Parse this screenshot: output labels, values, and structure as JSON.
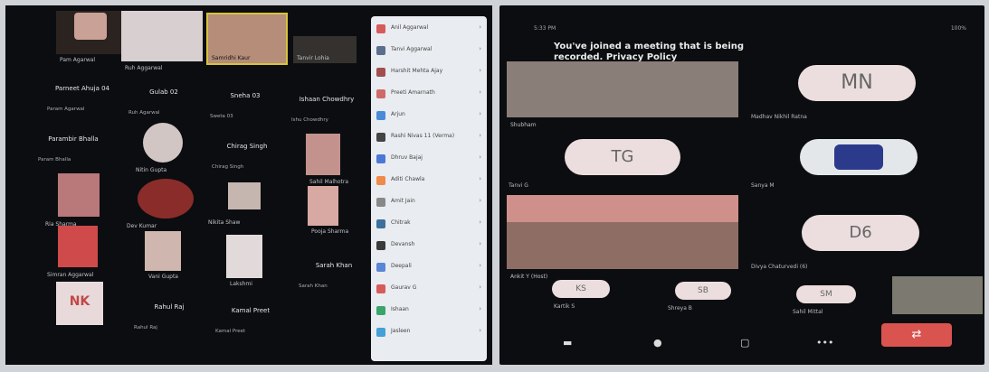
{
  "left_panel": {
    "top_tiles": [
      {
        "name": "Pam Agarwal",
        "color": "#c9a197"
      },
      {
        "name": "Ruh Aggarwal",
        "color": "#d7cfd0"
      },
      {
        "name": "Samridhi Kaur",
        "color": "#b58d79"
      },
      {
        "name": "Tanvir Lohia",
        "color": "#34312f"
      }
    ],
    "name_tiles": [
      {
        "name": "Parneet Ahuja 04",
        "sub": "Param Agarwal"
      },
      {
        "name": "Gulab 02",
        "sub": "Ruh Agarwal"
      },
      {
        "name": "Sneha 03",
        "sub": "Sweta 03"
      },
      {
        "name": "Ishaan Chowdhry",
        "sub": "Ishu Chowdhry"
      },
      {
        "name": "Parambir Bhalla",
        "sub": "Param Bhalla"
      },
      {
        "name": "Chirag Singh",
        "sub": "Chirag Singh"
      },
      {
        "name": "Sarah Khan",
        "sub": "Sarah Khan"
      },
      {
        "name": "Rahul Raj",
        "sub": "Rahul Raj"
      },
      {
        "name": "Kamal Preet",
        "sub": "Kamal Preet"
      }
    ],
    "video_tiles": [
      {
        "name": "Simran Aggarwal",
        "color": "#bf9d97"
      },
      {
        "name": "Nitin Gupta",
        "color": "#c9c9c9"
      },
      {
        "name": "Sahil Malhotra",
        "color": "#c3928d"
      },
      {
        "name": "Ria Sharma",
        "color": "#b9787a"
      },
      {
        "name": "Pooja Sharma",
        "color": "#d8a9a2"
      },
      {
        "name": "Nikita Shaw",
        "color": "#c6b6b0"
      },
      {
        "name": "Lakshmi",
        "color": "#e2dada"
      },
      {
        "name": "Dev Kumar",
        "color": "#7d2a28"
      },
      {
        "name": "Vani Gupta",
        "color": "#cfb6ae"
      }
    ],
    "nk_initials": "NK",
    "sidebar_items": [
      {
        "label": "Anil Aggarwal",
        "color": "#d65b5b"
      },
      {
        "label": "Tanvi Aggarwal",
        "color": "#5b6f8d"
      },
      {
        "label": "Harshit Mehta Ajay",
        "color": "#a04e4e"
      },
      {
        "label": "Preeti Amarnath",
        "color": "#d06a6a"
      },
      {
        "label": "Arjun",
        "color": "#4b8bd6"
      },
      {
        "label": "Rashi Nivas 11 (Verma)",
        "color": "#444444"
      },
      {
        "label": "Dhruv Bajaj",
        "color": "#4b78d6"
      },
      {
        "label": "Aditi Chawla",
        "color": "#f08a4b"
      },
      {
        "label": "Amit Jain",
        "color": "#888888"
      },
      {
        "label": "Chitrak",
        "color": "#3c6f9e"
      },
      {
        "label": "Devansh",
        "color": "#3a3a3a"
      },
      {
        "label": "Deepali",
        "color": "#5a86d6"
      },
      {
        "label": "Gaurav G",
        "color": "#d65b5b"
      },
      {
        "label": "Ishaan",
        "color": "#3aa56b"
      },
      {
        "label": "Jasleen",
        "color": "#44a0d6"
      }
    ]
  },
  "right_panel": {
    "status_bar": "5:33 PM",
    "battery": "100%",
    "banner_line1": "You've joined a meeting that is being",
    "banner_line2": "recorded. Privacy Policy",
    "participants": {
      "mn": {
        "initials": "MN",
        "label": "Madhav Nikhil Ratna"
      },
      "tg": {
        "initials": "TG",
        "label": "Tanvi G"
      },
      "agent": {
        "label": "Sanya M"
      },
      "d6": {
        "initials": "D6",
        "label": "Divya Chaturvedi (6)"
      },
      "video_top": {
        "label": "Shubham"
      },
      "video_bottom": {
        "label": "Ankit Y (Host)"
      },
      "ks": {
        "initials": "KS",
        "label": "Kartik S"
      },
      "sb": {
        "initials": "SB",
        "label": "Shreya B"
      },
      "sm": {
        "initials": "SM",
        "label": "Sahil Mittal"
      }
    },
    "controls": {
      "cam": "▬",
      "mic": "●",
      "chat": "▢",
      "more": "•••",
      "leave": "⇄"
    }
  },
  "colors": {
    "panel_bg": "#0c0d10",
    "leave": "#d9534f",
    "avatar_bg": "#ecdede"
  }
}
